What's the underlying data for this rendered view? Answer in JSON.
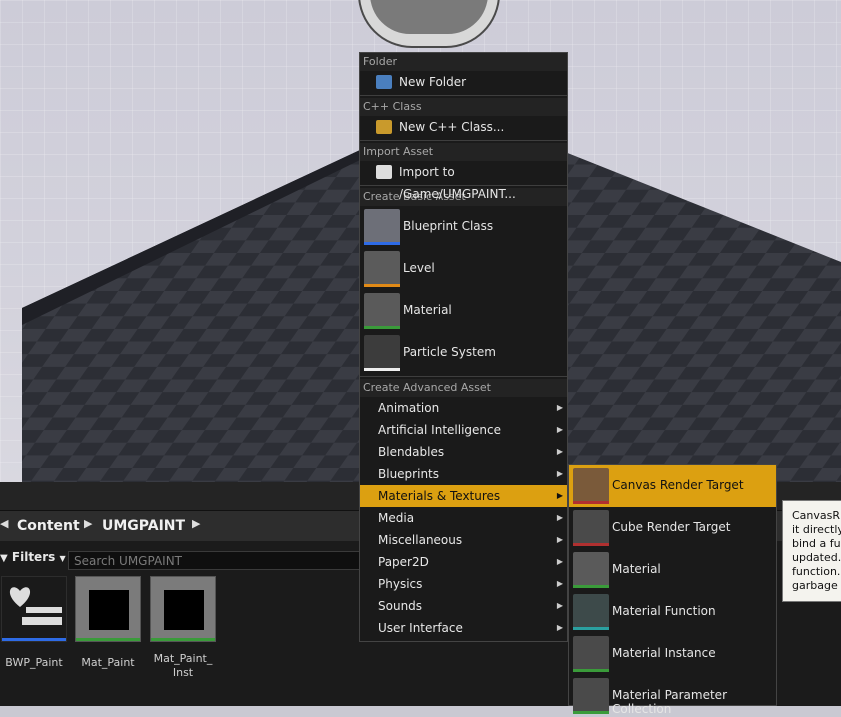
{
  "colors": {
    "highlight": "#dca011",
    "blueprint": "#2e6be6",
    "level": "#e08a17",
    "material": "#3a9b3a",
    "particle": "#eeeeee",
    "teal": "#2aa0a0"
  },
  "breadcrumb": [
    "Content",
    "UMGPAINT"
  ],
  "filters_label": "Filters",
  "search_placeholder": "Search UMGPAINT",
  "assets": [
    {
      "name": "BWP_Paint",
      "icon": "widget-blueprint-icon"
    },
    {
      "name": "Mat_Paint",
      "icon": "material-thumbnail"
    },
    {
      "name": "Mat_Paint_Inst",
      "label_lines": [
        "Mat_Paint_",
        "Inst"
      ],
      "icon": "material-instance-thumbnail"
    }
  ],
  "context_menu": {
    "folder_header": "Folder",
    "new_folder": "New Folder",
    "cpp_header": "C++ Class",
    "new_cpp": "New C++ Class...",
    "import_header": "Import Asset",
    "import": "Import to /Game/UMGPAINT...",
    "basic_header": "Create Basic Asset",
    "basic": [
      "Blueprint Class",
      "Level",
      "Material",
      "Particle System"
    ],
    "advanced_header": "Create Advanced Asset",
    "advanced": [
      "Animation",
      "Artificial Intelligence",
      "Blendables",
      "Blueprints",
      "Materials & Textures",
      "Media",
      "Miscellaneous",
      "Paper2D",
      "Physics",
      "Sounds",
      "User Interface"
    ],
    "highlighted": "Materials & Textures"
  },
  "submenu": [
    "Canvas Render Target",
    "Cube Render Target",
    "Material",
    "Material Function",
    "Material Instance",
    "Material Parameter Collection"
  ],
  "tooltip_lines": [
    "CanvasR",
    "it directly",
    "bind a fu",
    "updated.",
    "function.",
    "garbage c"
  ]
}
